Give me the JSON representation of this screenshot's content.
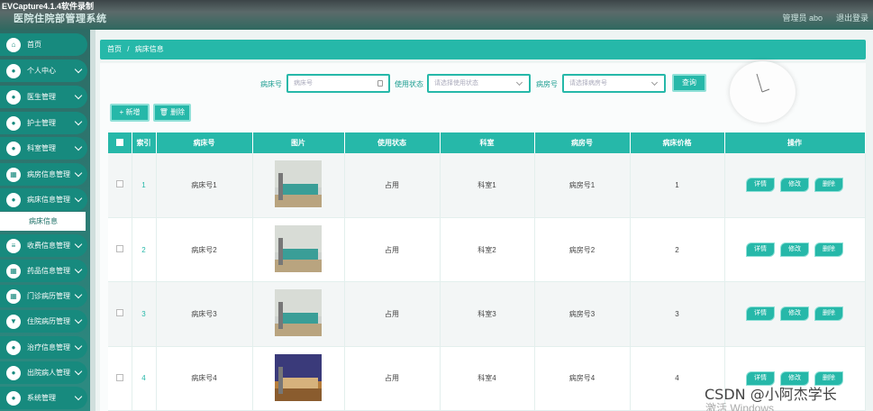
{
  "window": {
    "capture_title": "EVCapture4.1.4软件录制",
    "system_title": "医院住院部管理系统",
    "user": "管理员 abo",
    "logout": "退出登录"
  },
  "sidebar": {
    "items": [
      {
        "label": "首页",
        "icon": "home-icon",
        "glyph": "⌂",
        "chevron": false
      },
      {
        "label": "个人中心",
        "icon": "user-icon",
        "glyph": "●",
        "chevron": true
      },
      {
        "label": "医生管理",
        "icon": "doctor-icon",
        "glyph": "●",
        "chevron": true
      },
      {
        "label": "护士管理",
        "icon": "nurse-icon",
        "glyph": "●",
        "chevron": true
      },
      {
        "label": "科室管理",
        "icon": "department-icon",
        "glyph": "●",
        "chevron": true
      },
      {
        "label": "病房信息管理",
        "icon": "ward-icon",
        "glyph": "▦",
        "chevron": true
      },
      {
        "label": "病床信息管理",
        "icon": "bed-icon",
        "glyph": "●",
        "chevron": true
      },
      {
        "label": "收费信息管理",
        "icon": "fee-icon",
        "glyph": "≡",
        "chevron": true
      },
      {
        "label": "药品信息管理",
        "icon": "medicine-icon",
        "glyph": "▦",
        "chevron": true
      },
      {
        "label": "门诊病历管理",
        "icon": "record-icon",
        "glyph": "▦",
        "chevron": true
      },
      {
        "label": "住院病历管理",
        "icon": "inpatient-icon",
        "glyph": "▼",
        "chevron": true
      },
      {
        "label": "治疗信息管理",
        "icon": "treatment-icon",
        "glyph": "●",
        "chevron": true
      },
      {
        "label": "出院病人管理",
        "icon": "discharge-icon",
        "glyph": "●",
        "chevron": true
      },
      {
        "label": "系统管理",
        "icon": "system-icon",
        "glyph": "●",
        "chevron": true
      }
    ],
    "submenu_active": "病床信息"
  },
  "breadcrumb": {
    "home": "首页",
    "separator": "/",
    "current": "病床信息"
  },
  "search": {
    "bed_no_label": "病床号",
    "bed_no_placeholder": "病床号",
    "status_label": "使用状态",
    "status_placeholder": "请选择使用状态",
    "room_label": "病房号",
    "room_placeholder": "请选择病房号",
    "query_button": "查询"
  },
  "toolbar": {
    "add_label": "+ 新增",
    "delete_label": "🗑 删除"
  },
  "table": {
    "headers": [
      "索引",
      "病床号",
      "图片",
      "使用状态",
      "科室",
      "病房号",
      "病床价格",
      "操作"
    ],
    "rows": [
      {
        "index": "1",
        "bed_no": "病床号1",
        "status": "占用",
        "department": "科室1",
        "room_no": "病房号1",
        "price": "1",
        "style": "odd",
        "photo": "ward"
      },
      {
        "index": "2",
        "bed_no": "病床号2",
        "status": "占用",
        "department": "科室2",
        "room_no": "病房号2",
        "price": "2",
        "style": "even",
        "photo": "ward"
      },
      {
        "index": "3",
        "bed_no": "病床号3",
        "status": "占用",
        "department": "科室3",
        "room_no": "病房号3",
        "price": "3",
        "style": "odd",
        "photo": "ward"
      },
      {
        "index": "4",
        "bed_no": "病床号4",
        "status": "占用",
        "department": "科室4",
        "room_no": "病房号4",
        "price": "4",
        "style": "even",
        "photo": "warm"
      }
    ],
    "actions": {
      "detail": "详情",
      "edit": "修改",
      "delete": "删除"
    }
  },
  "watermark": {
    "text": "CSDN @小阿杰学长",
    "windows": "激活 Windows"
  },
  "colors": {
    "accent": "#26b8a9",
    "sidebar": "#178a7e"
  }
}
